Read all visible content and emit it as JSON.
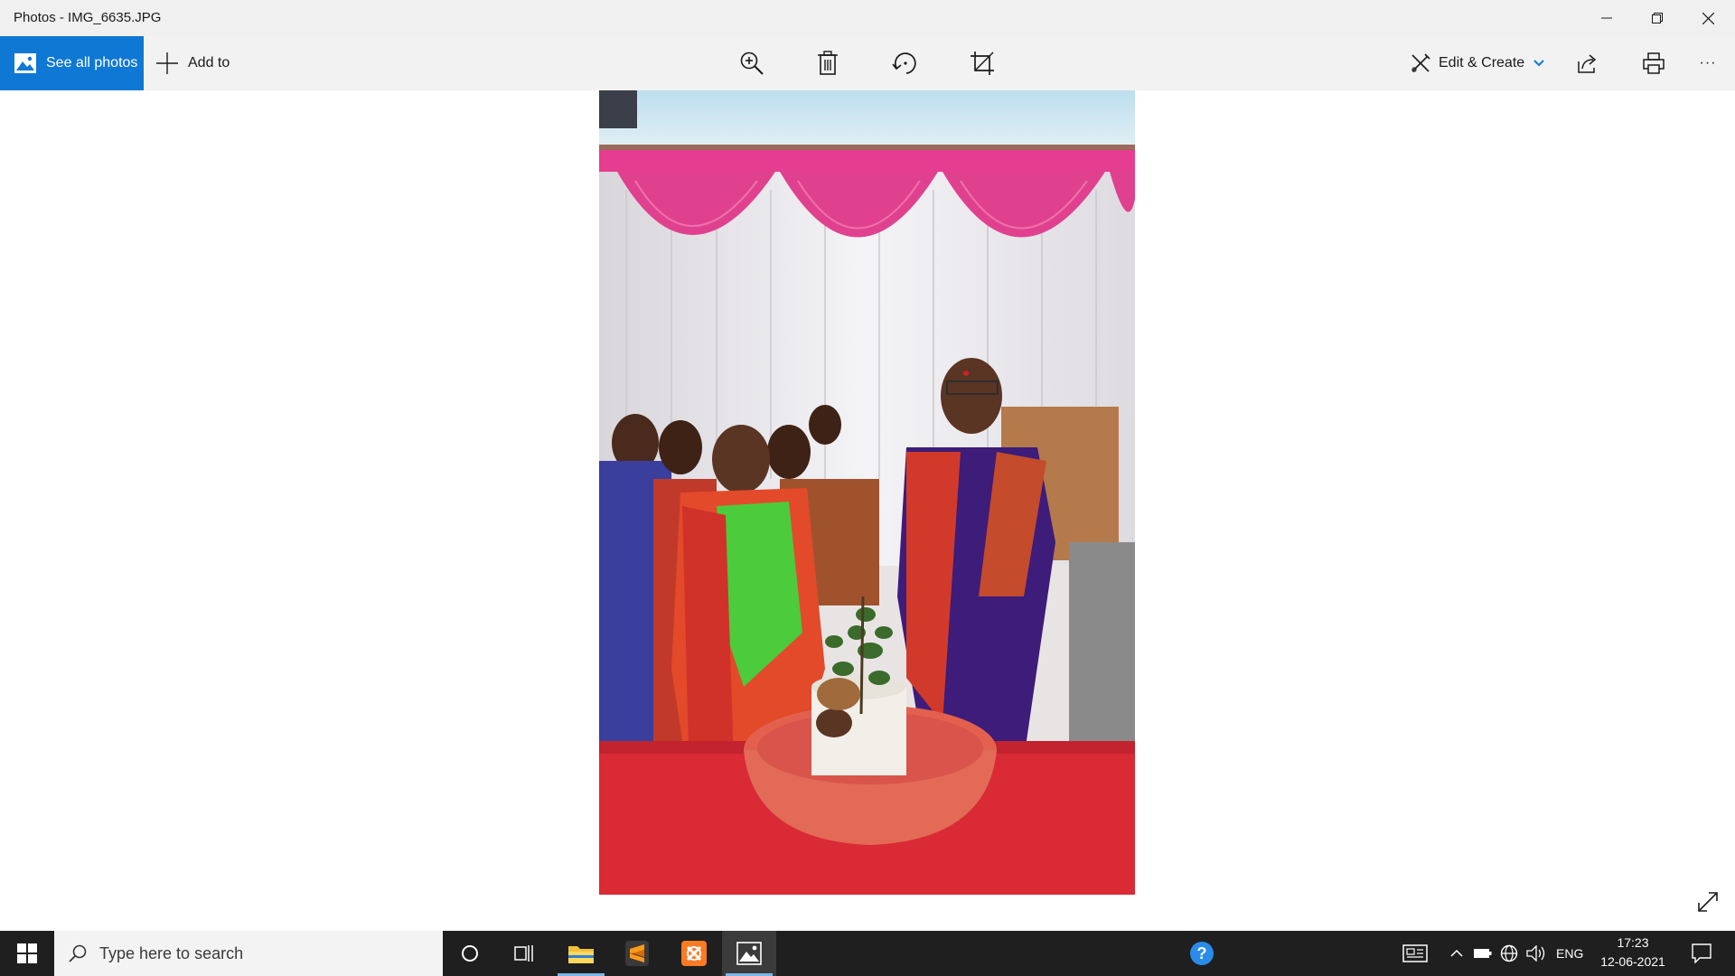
{
  "window": {
    "title": "Photos - IMG_6635.JPG"
  },
  "toolbar": {
    "see_all_photos": "See all photos",
    "add_to": "Add to",
    "edit_create": "Edit & Create",
    "more": "···"
  },
  "photo": {
    "description_icons": [
      "zoom-icon",
      "delete-icon",
      "rotate-icon",
      "crop-icon",
      "share-icon",
      "print-icon"
    ]
  },
  "taskbar": {
    "search_placeholder": "Type here to search",
    "language": "ENG",
    "time": "17:23",
    "date": "12-06-2021"
  },
  "colors": {
    "accent": "#0f78d4",
    "taskbar": "#1f1f1f",
    "titlebar": "#f0f0f0"
  }
}
